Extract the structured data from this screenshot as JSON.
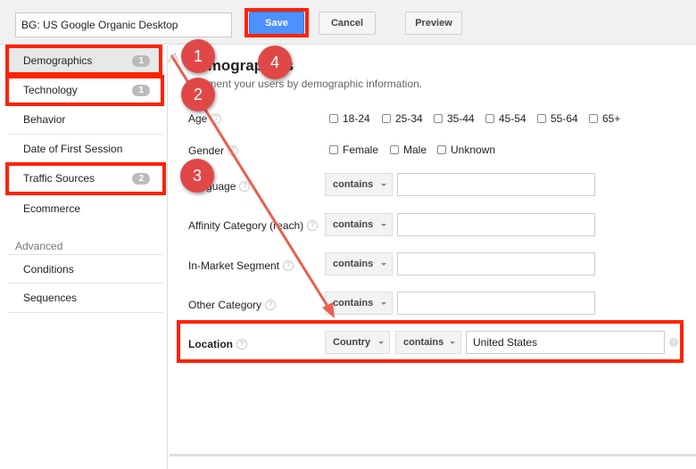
{
  "header": {
    "segment_name": "BG: US Google Organic Desktop",
    "save": "Save",
    "cancel": "Cancel",
    "preview": "Preview"
  },
  "sidebar": {
    "items": [
      {
        "label": "Demographics",
        "count": "1"
      },
      {
        "label": "Technology",
        "count": "1"
      },
      {
        "label": "Behavior"
      },
      {
        "label": "Date of First Session"
      },
      {
        "label": "Traffic Sources",
        "count": "2"
      },
      {
        "label": "Ecommerce"
      }
    ],
    "advanced_heading": "Advanced",
    "advanced_items": [
      {
        "label": "Conditions"
      },
      {
        "label": "Sequences"
      }
    ]
  },
  "main": {
    "title": "Demographics",
    "subtitle": "Segment your users by demographic information.",
    "age": {
      "label": "Age",
      "options": [
        "18-24",
        "25-34",
        "35-44",
        "45-54",
        "55-64",
        "65+"
      ]
    },
    "gender": {
      "label": "Gender",
      "options": [
        "Female",
        "Male",
        "Unknown"
      ]
    },
    "rows": [
      {
        "label": "Language",
        "operator": "contains",
        "value": ""
      },
      {
        "label": "Affinity Category (reach)",
        "operator": "contains",
        "value": ""
      },
      {
        "label": "In-Market Segment",
        "operator": "contains",
        "value": ""
      },
      {
        "label": "Other Category",
        "operator": "contains",
        "value": ""
      }
    ],
    "location": {
      "label": "Location",
      "dimension": "Country",
      "operator": "contains",
      "value": "United States"
    }
  },
  "annotations": {
    "markers": [
      "1",
      "2",
      "3",
      "4"
    ],
    "highlight_color": "#ff2200",
    "marker_color": "#e04848"
  }
}
